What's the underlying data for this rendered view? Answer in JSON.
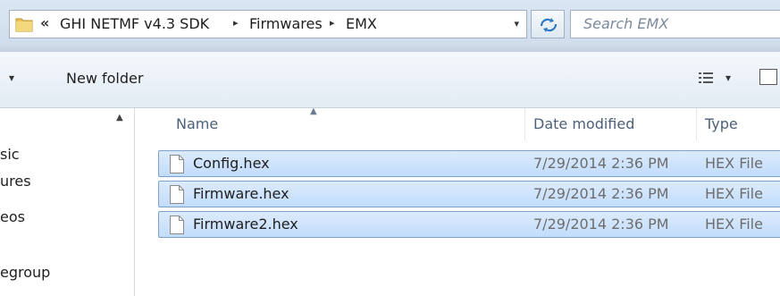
{
  "address": {
    "chevron": "«",
    "crumbs": [
      "GHI NETMF v4.3 SDK",
      "Firmwares",
      "EMX"
    ],
    "separator": "▸",
    "dropdown": "▾"
  },
  "search": {
    "placeholder": "Search EMX"
  },
  "toolbar": {
    "left_dropdown": "▾",
    "new_folder_label": "New folder",
    "view_dropdown": "▾"
  },
  "nav": {
    "items": [
      "sic",
      "ures",
      "eos",
      "egroup"
    ],
    "scroll_up": "▲"
  },
  "columns": {
    "name": "Name",
    "date": "Date modified",
    "type": "Type",
    "sort_arrow": "▲"
  },
  "files": [
    {
      "name": "Config.hex",
      "date": "7/29/2014 2:36 PM",
      "type": "HEX File"
    },
    {
      "name": "Firmware.hex",
      "date": "7/29/2014 2:36 PM",
      "type": "HEX File"
    },
    {
      "name": "Firmware2.hex",
      "date": "7/29/2014 2:36 PM",
      "type": "HEX File"
    }
  ],
  "colors": {
    "selection": "#c1dcfc",
    "selection_border": "#7da2ce",
    "header_text": "#4c607a"
  },
  "icons": {
    "folder": "folder-icon",
    "refresh": "refresh-icon",
    "file": "file-icon",
    "view": "view-icon",
    "preview_pane": "preview-pane-icon"
  }
}
